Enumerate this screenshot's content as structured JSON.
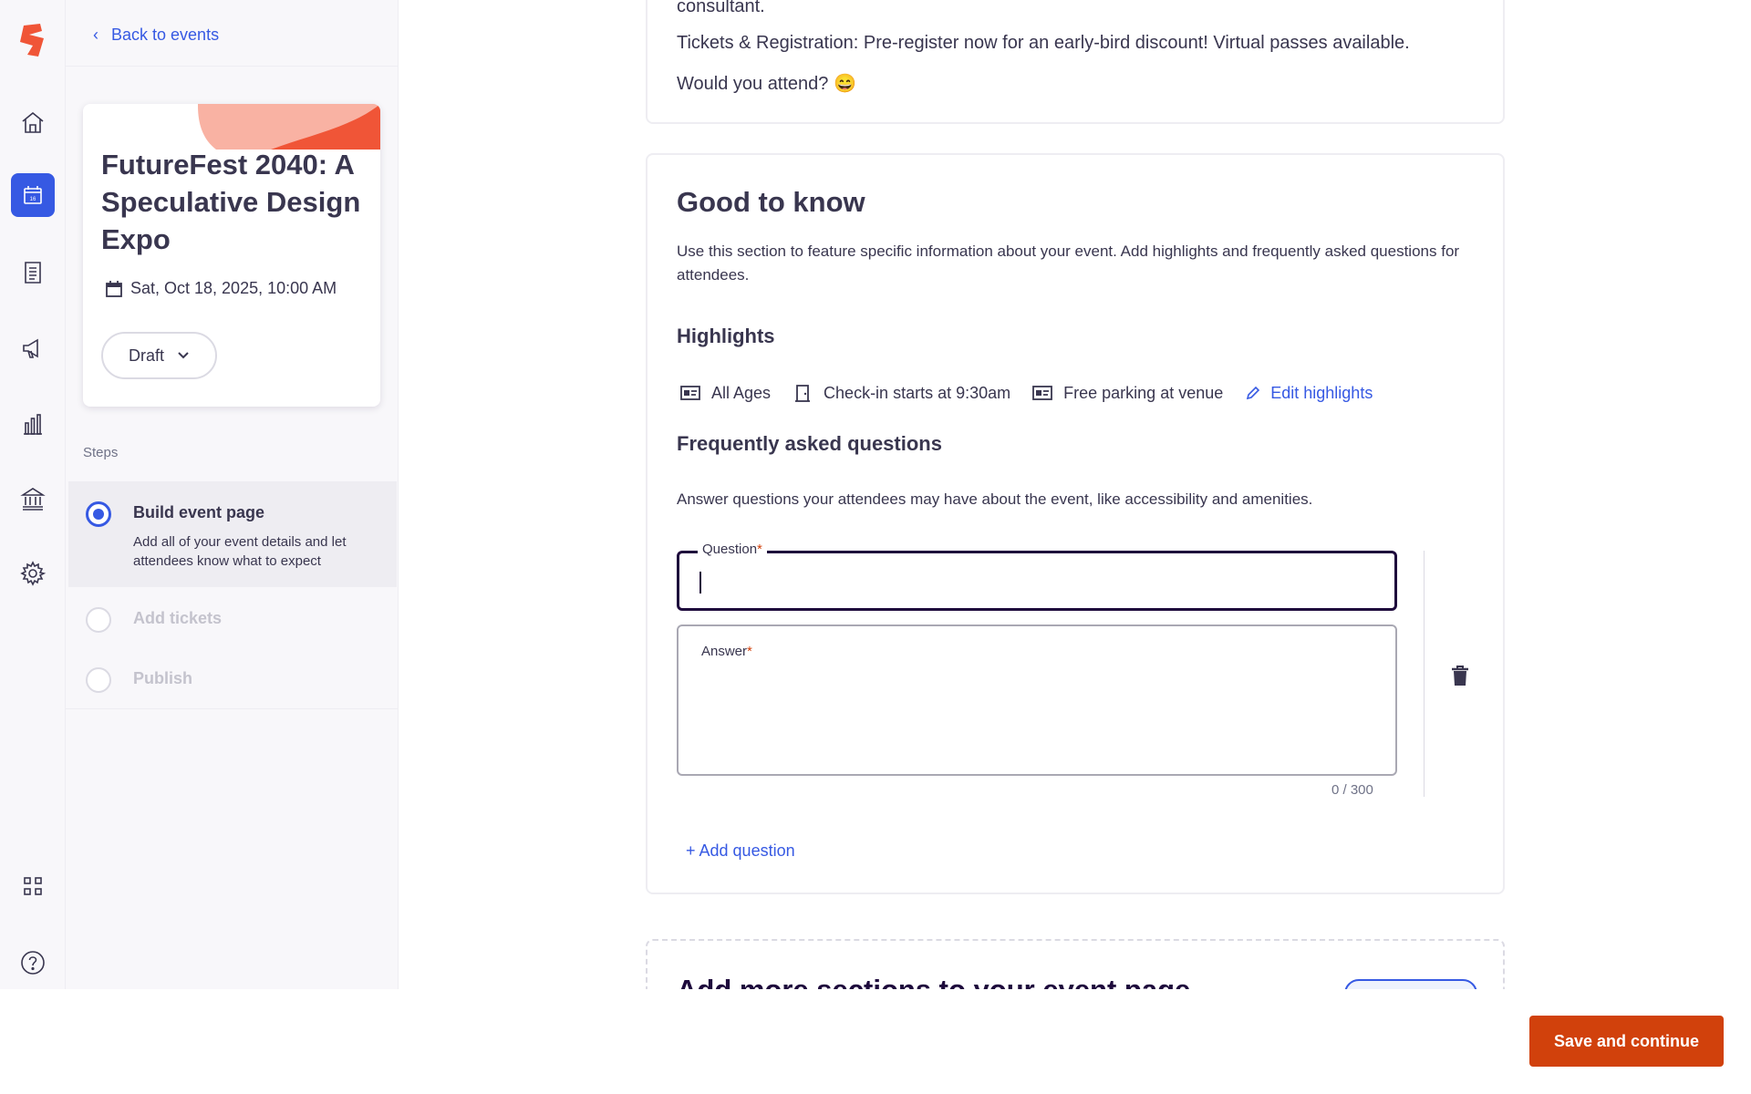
{
  "nav": {
    "back_label": "Back to events",
    "icons": [
      "home-icon",
      "calendar-icon",
      "orders-icon",
      "marketing-icon",
      "reports-icon",
      "finance-icon",
      "settings-icon",
      "apps-icon",
      "help-icon"
    ],
    "calendar_day": "16",
    "accent": "#3659e3",
    "brand": "#f05537"
  },
  "event": {
    "title": "FutureFest 2040: A Speculative Design Expo",
    "date": "Sat, Oct 18, 2025, 10:00 AM",
    "status": "Draft"
  },
  "steps": {
    "label": "Steps",
    "items": [
      {
        "title": "Build event page",
        "description": "Add all of your event details and let attendees know what to expect",
        "state": "active"
      },
      {
        "title": "Add tickets",
        "description": "",
        "state": "disabled"
      },
      {
        "title": "Publish",
        "description": "",
        "state": "disabled"
      }
    ]
  },
  "description_tail": {
    "line1": "consultant.",
    "line2": "Tickets & Registration: Pre-register now for an early-bird discount! Virtual passes available.",
    "line3": "Would you attend? 😄"
  },
  "good_to_know": {
    "title": "Good to know",
    "intro": "Use this section to feature specific information about your event. Add highlights and frequently asked questions for attendees.",
    "highlights_title": "Highlights",
    "highlights": [
      {
        "icon": "id-card-icon",
        "label": "All Ages"
      },
      {
        "icon": "door-icon",
        "label": "Check-in starts at 9:30am"
      },
      {
        "icon": "id-card-icon",
        "label": "Free parking at venue"
      }
    ],
    "edit_highlights": "Edit highlights",
    "faq_title": "Frequently asked questions",
    "faq_intro": "Answer questions your attendees may have about the event, like accessibility and amenities.",
    "question_label": "Question",
    "answer_label": "Answer",
    "required_mark": "*",
    "char_count": "0 / 300",
    "add_question": "+ Add question"
  },
  "more_sections": {
    "title": "Add more sections to your event page"
  },
  "footer": {
    "save_label": "Save and continue",
    "save_color": "#d1410c"
  }
}
